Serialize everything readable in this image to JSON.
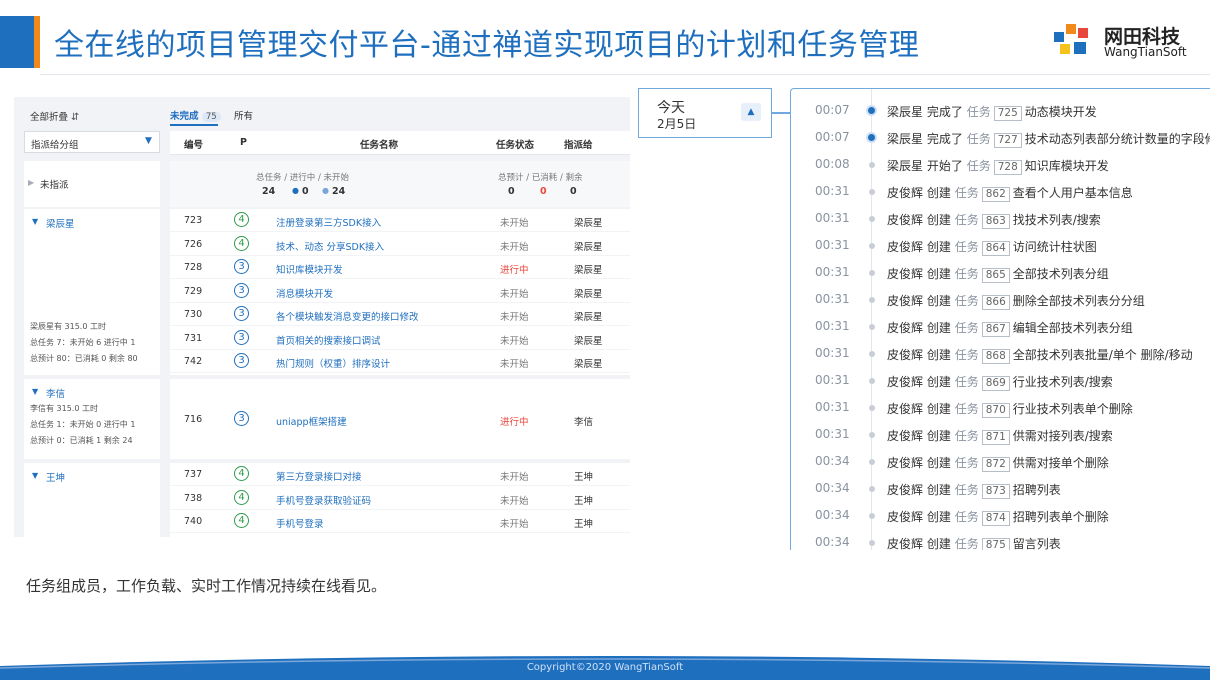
{
  "header": {
    "title": "全在线的项目管理交付平台-通过禅道实现项目的计划和任务管理",
    "brand_cn": "网田科技",
    "brand_en": "WangTianSoft"
  },
  "left_panel": {
    "collapse_all": "全部折叠",
    "group_select": "指派给分组",
    "tabs": [
      {
        "label": "未完成",
        "count": "75"
      },
      {
        "label": "所有"
      }
    ],
    "columns": [
      "编号",
      "P",
      "任务名称",
      "任务状态",
      "指派给"
    ],
    "unassigned_label": "未指派",
    "summary_tasks_label": "总任务 / 进行中 / 未开始",
    "summary_tasks_total": "24",
    "summary_tasks_doing": "0",
    "summary_tasks_wait": "24",
    "summary_hours_label": "总预计 / 已消耗 / 剩余",
    "summary_hours_est": "0",
    "summary_hours_consumed": "0",
    "summary_hours_left": "0",
    "groups": [
      {
        "name": "梁辰星",
        "stats": [
          "梁辰星有 315.0 工时",
          "总任务 7：未开始 6   进行中 1",
          "总预计 80：已消耗 0   剩余 80"
        ],
        "rows": [
          {
            "id": "723",
            "pri": "4",
            "name": "注册登录第三方SDK接入",
            "status": "未开始",
            "assignee": "梁辰星"
          },
          {
            "id": "726",
            "pri": "4",
            "name": "技术、动态 分享SDK接入",
            "status": "未开始",
            "assignee": "梁辰星"
          },
          {
            "id": "728",
            "pri": "3",
            "name": "知识库模块开发",
            "status": "进行中",
            "assignee": "梁辰星"
          },
          {
            "id": "729",
            "pri": "3",
            "name": "消息模块开发",
            "status": "未开始",
            "assignee": "梁辰星"
          },
          {
            "id": "730",
            "pri": "3",
            "name": "各个模块触发消息变更的接口修改",
            "status": "未开始",
            "assignee": "梁辰星"
          },
          {
            "id": "731",
            "pri": "3",
            "name": "首页相关的搜索接口调试",
            "status": "未开始",
            "assignee": "梁辰星"
          },
          {
            "id": "742",
            "pri": "3",
            "name": "热门规则（权重）排序设计",
            "status": "未开始",
            "assignee": "梁辰星"
          }
        ]
      },
      {
        "name": "李信",
        "stats": [
          "李信有 315.0 工时",
          "总任务 1：未开始 0   进行中 1",
          "总预计 0：已消耗 1   剩余 24"
        ],
        "rows": [
          {
            "id": "716",
            "pri": "3",
            "name": "uniapp框架搭建",
            "status": "进行中",
            "assignee": "李信"
          }
        ]
      },
      {
        "name": "王坤",
        "stats": [],
        "rows": [
          {
            "id": "737",
            "pri": "4",
            "name": "第三方登录接口对接",
            "status": "未开始",
            "assignee": "王坤"
          },
          {
            "id": "738",
            "pri": "4",
            "name": "手机号登录获取验证码",
            "status": "未开始",
            "assignee": "王坤"
          },
          {
            "id": "740",
            "pri": "4",
            "name": "手机号登录",
            "status": "未开始",
            "assignee": "王坤"
          }
        ]
      }
    ]
  },
  "timeline": {
    "today_label": "今天",
    "today_date": "2月5日",
    "task_word": "任务",
    "items": [
      {
        "time": "00:07",
        "user": "梁辰星",
        "action": "完成了",
        "id": "725",
        "title": "动态模块开发",
        "strong": true
      },
      {
        "time": "00:07",
        "user": "梁辰星",
        "action": "完成了",
        "id": "727",
        "title": "技术动态列表部分统计数量的字段修改",
        "strong": true
      },
      {
        "time": "00:08",
        "user": "梁辰星",
        "action": "开始了",
        "id": "728",
        "title": "知识库模块开发",
        "strong": false
      },
      {
        "time": "00:31",
        "user": "皮俊辉",
        "action": "创建",
        "id": "862",
        "title": "查看个人用户基本信息",
        "strong": false
      },
      {
        "time": "00:31",
        "user": "皮俊辉",
        "action": "创建",
        "id": "863",
        "title": "找技术列表/搜索",
        "strong": false
      },
      {
        "time": "00:31",
        "user": "皮俊辉",
        "action": "创建",
        "id": "864",
        "title": "访问统计柱状图",
        "strong": false
      },
      {
        "time": "00:31",
        "user": "皮俊辉",
        "action": "创建",
        "id": "865",
        "title": "全部技术列表分组",
        "strong": false
      },
      {
        "time": "00:31",
        "user": "皮俊辉",
        "action": "创建",
        "id": "866",
        "title": "删除全部技术列表分分组",
        "strong": false
      },
      {
        "time": "00:31",
        "user": "皮俊辉",
        "action": "创建",
        "id": "867",
        "title": "编辑全部技术列表分组",
        "strong": false
      },
      {
        "time": "00:31",
        "user": "皮俊辉",
        "action": "创建",
        "id": "868",
        "title": "全部技术列表批量/单个 删除/移动",
        "strong": false
      },
      {
        "time": "00:31",
        "user": "皮俊辉",
        "action": "创建",
        "id": "869",
        "title": "行业技术列表/搜索",
        "strong": false
      },
      {
        "time": "00:31",
        "user": "皮俊辉",
        "action": "创建",
        "id": "870",
        "title": "行业技术列表单个删除",
        "strong": false
      },
      {
        "time": "00:31",
        "user": "皮俊辉",
        "action": "创建",
        "id": "871",
        "title": "供需对接列表/搜索",
        "strong": false
      },
      {
        "time": "00:34",
        "user": "皮俊辉",
        "action": "创建",
        "id": "872",
        "title": "供需对接单个删除",
        "strong": false
      },
      {
        "time": "00:34",
        "user": "皮俊辉",
        "action": "创建",
        "id": "873",
        "title": "招聘列表",
        "strong": false
      },
      {
        "time": "00:34",
        "user": "皮俊辉",
        "action": "创建",
        "id": "874",
        "title": "招聘列表单个删除",
        "strong": false
      },
      {
        "time": "00:34",
        "user": "皮俊辉",
        "action": "创建",
        "id": "875",
        "title": "留言列表",
        "strong": false
      }
    ]
  },
  "caption": "任务组成员，工作负载、实时工作情况持续在线看见。",
  "footer": "Copyright©2020 WangTianSoft",
  "colors": {
    "primary": "#1f6fbf",
    "accent": "#f08a1a",
    "pri4": "#2e9c4a",
    "pri3": "#1f6fbf",
    "doing": "#e8473b",
    "panel_bg": "#f1f3f6"
  },
  "icons": [
    "sort-icon",
    "chevron-down-icon",
    "caret-right-icon",
    "caret-down-icon",
    "chevron-up-icon",
    "logo-icon"
  ]
}
